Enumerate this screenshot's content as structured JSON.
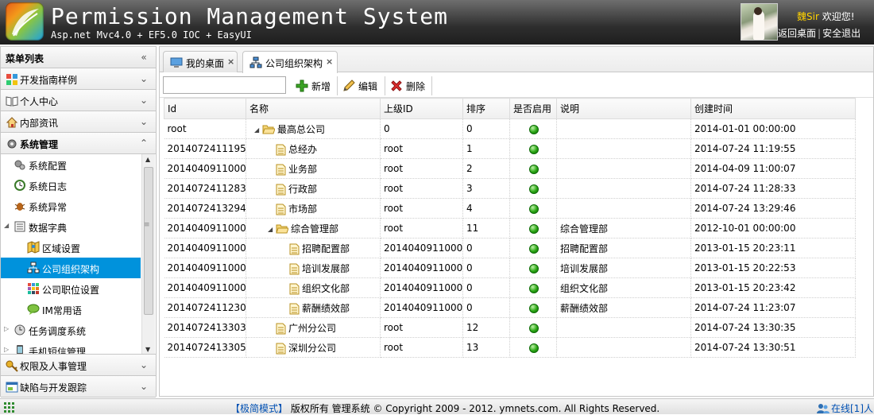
{
  "header": {
    "title": "Permission Management System",
    "subtitle": "Asp.net Mvc4.0 + EF5.0 IOC + EasyUI",
    "user_name": "魏Sir",
    "welcome": "欢迎您!",
    "link_desktop": "返回桌面",
    "link_logout": "安全退出"
  },
  "sidebar": {
    "title": "菜单列表",
    "sections_top": [
      {
        "label": "开发指南样例",
        "icon": "palette-icon"
      },
      {
        "label": "个人中心",
        "icon": "book-icon"
      },
      {
        "label": "内部资讯",
        "icon": "home-icon"
      },
      {
        "label": "系统管理",
        "icon": "gear-icon"
      }
    ],
    "tree": [
      {
        "label": "系统配置"
      },
      {
        "label": "系统日志"
      },
      {
        "label": "系统异常"
      },
      {
        "label": "数据字典"
      },
      {
        "label": "区域设置"
      },
      {
        "label": "公司组织架构"
      },
      {
        "label": "公司职位设置"
      },
      {
        "label": "IM常用语"
      },
      {
        "label": "任务调度系统"
      },
      {
        "label": "手机短信管理"
      }
    ],
    "sections_bottom": [
      {
        "label": "权限及人事管理",
        "icon": "key-icon"
      },
      {
        "label": "缺陷与开发跟踪",
        "icon": "window-icon"
      }
    ]
  },
  "tabs": [
    {
      "label": "我的桌面"
    },
    {
      "label": "公司组织架构"
    }
  ],
  "toolbar": {
    "search_value": "",
    "add": "新增",
    "edit": "编辑",
    "delete": "删除"
  },
  "grid": {
    "columns": [
      "Id",
      "名称",
      "上级ID",
      "排序",
      "是否启用",
      "说明",
      "创建时间"
    ],
    "rows": [
      {
        "id": "root",
        "name": "最高总公司",
        "parent": "0",
        "sort": "0",
        "desc": "",
        "created": "2014-01-01 00:00:00"
      },
      {
        "id": "20140724111955",
        "name": "总经办",
        "parent": "root",
        "sort": "1",
        "desc": "",
        "created": "2014-07-24 11:19:55"
      },
      {
        "id": "20140409110007",
        "name": "业务部",
        "parent": "root",
        "sort": "2",
        "desc": "",
        "created": "2014-04-09 11:00:07"
      },
      {
        "id": "20140724112833",
        "name": "行政部",
        "parent": "root",
        "sort": "3",
        "desc": "",
        "created": "2014-07-24 11:28:33"
      },
      {
        "id": "20140724132946",
        "name": "市场部",
        "parent": "root",
        "sort": "4",
        "desc": "",
        "created": "2014-07-24 13:29:46"
      },
      {
        "id": "20140409110007",
        "name": "综合管理部",
        "parent": "root",
        "sort": "11",
        "desc": "综合管理部",
        "created": "2012-10-01 00:00:00"
      },
      {
        "id": "20140409110007",
        "name": "招聘配置部",
        "parent": "20140409110007",
        "sort": "0",
        "desc": "招聘配置部",
        "created": "2013-01-15 20:23:11"
      },
      {
        "id": "20140409110007",
        "name": "培训发展部",
        "parent": "20140409110007",
        "sort": "0",
        "desc": "培训发展部",
        "created": "2013-01-15 20:22:53"
      },
      {
        "id": "20140409110007",
        "name": "组织文化部",
        "parent": "20140409110007",
        "sort": "0",
        "desc": "组织文化部",
        "created": "2013-01-15 20:23:42"
      },
      {
        "id": "20140724112307",
        "name": "薪酬绩效部",
        "parent": "20140409110007",
        "sort": "0",
        "desc": "薪酬绩效部",
        "created": "2014-07-24 11:23:07"
      },
      {
        "id": "20140724133035",
        "name": "广州分公司",
        "parent": "root",
        "sort": "12",
        "desc": "",
        "created": "2014-07-24 13:30:35"
      },
      {
        "id": "20140724133051",
        "name": "深圳分公司",
        "parent": "root",
        "sort": "13",
        "desc": "",
        "created": "2014-07-24 13:30:51"
      }
    ]
  },
  "footer": {
    "mode": "【极简模式】",
    "copyright": "版权所有 管理系统 © Copyright 2009 - 2012. ymnets.com. All Rights Reserved.",
    "online": "在线[1]人"
  }
}
